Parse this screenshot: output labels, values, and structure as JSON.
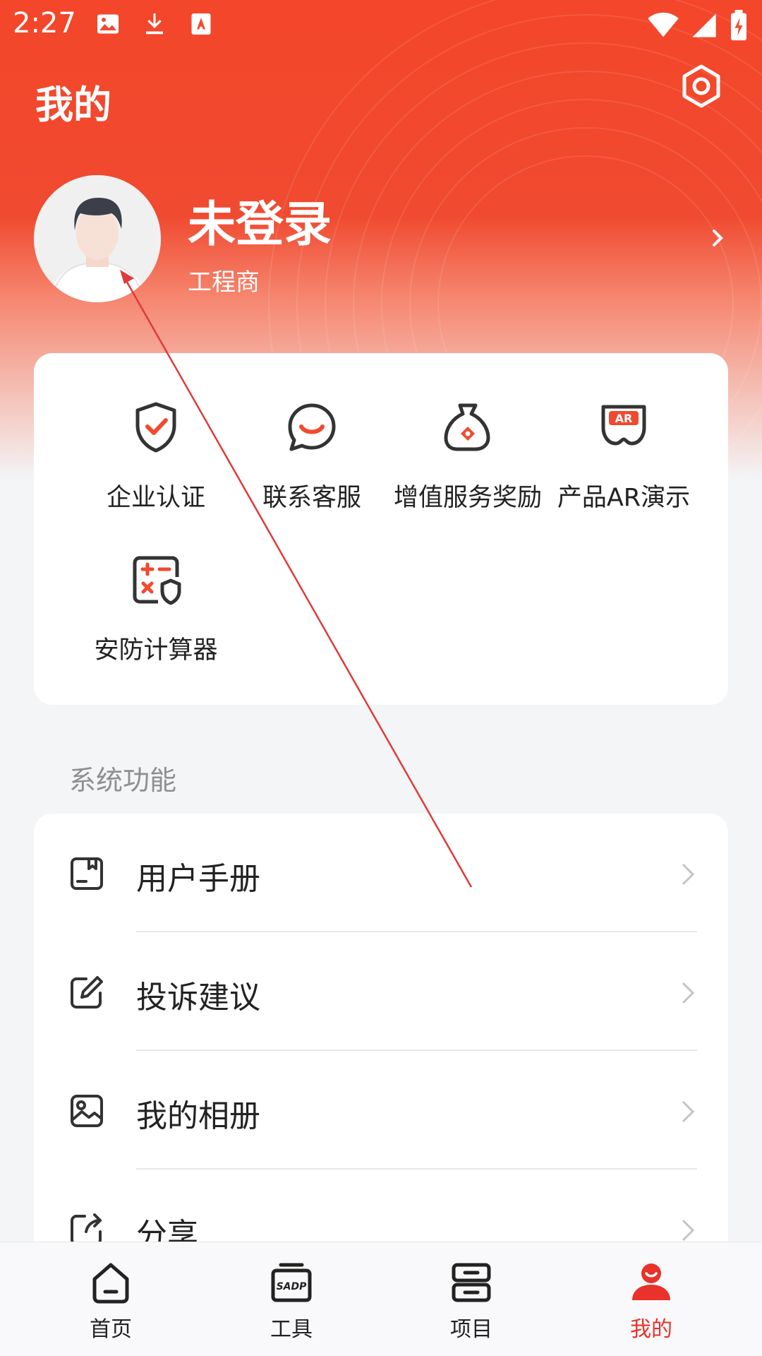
{
  "status_bar": {
    "time": "2:27",
    "left_icons": [
      "image-icon",
      "download-icon",
      "accessibility-icon"
    ],
    "right_icons": [
      "wifi-icon",
      "cellular-signal-icon",
      "battery-charging-icon"
    ]
  },
  "header": {
    "title": "我的",
    "settings_icon": "settings-hexagon-icon"
  },
  "profile": {
    "name": "未登录",
    "role": "工程商"
  },
  "quick_actions": [
    {
      "label": "企业认证",
      "icon": "shield-check-icon"
    },
    {
      "label": "联系客服",
      "icon": "chat-smile-icon"
    },
    {
      "label": "增值服务奖励",
      "icon": "money-bag-icon"
    },
    {
      "label": "产品AR演示",
      "icon": "ar-glasses-icon"
    },
    {
      "label": "安防计算器",
      "icon": "calculator-shield-icon"
    }
  ],
  "section": {
    "title": "系统功能"
  },
  "menu": [
    {
      "label": "用户手册",
      "icon": "manual-icon"
    },
    {
      "label": "投诉建议",
      "icon": "edit-icon"
    },
    {
      "label": "我的相册",
      "icon": "album-icon"
    },
    {
      "label": "分享",
      "icon": "share-icon"
    }
  ],
  "bottom_nav": [
    {
      "label": "首页",
      "icon": "home-icon",
      "active": false
    },
    {
      "label": "工具",
      "icon": "sadp-tool-icon",
      "active": false,
      "icon_text": "SADP"
    },
    {
      "label": "项目",
      "icon": "project-icon",
      "active": false
    },
    {
      "label": "我的",
      "icon": "profile-icon",
      "active": true
    }
  ],
  "colors": {
    "brand_red": "#f04a30",
    "active_nav": "#e8322a",
    "muted_text": "#8f8f8f"
  }
}
